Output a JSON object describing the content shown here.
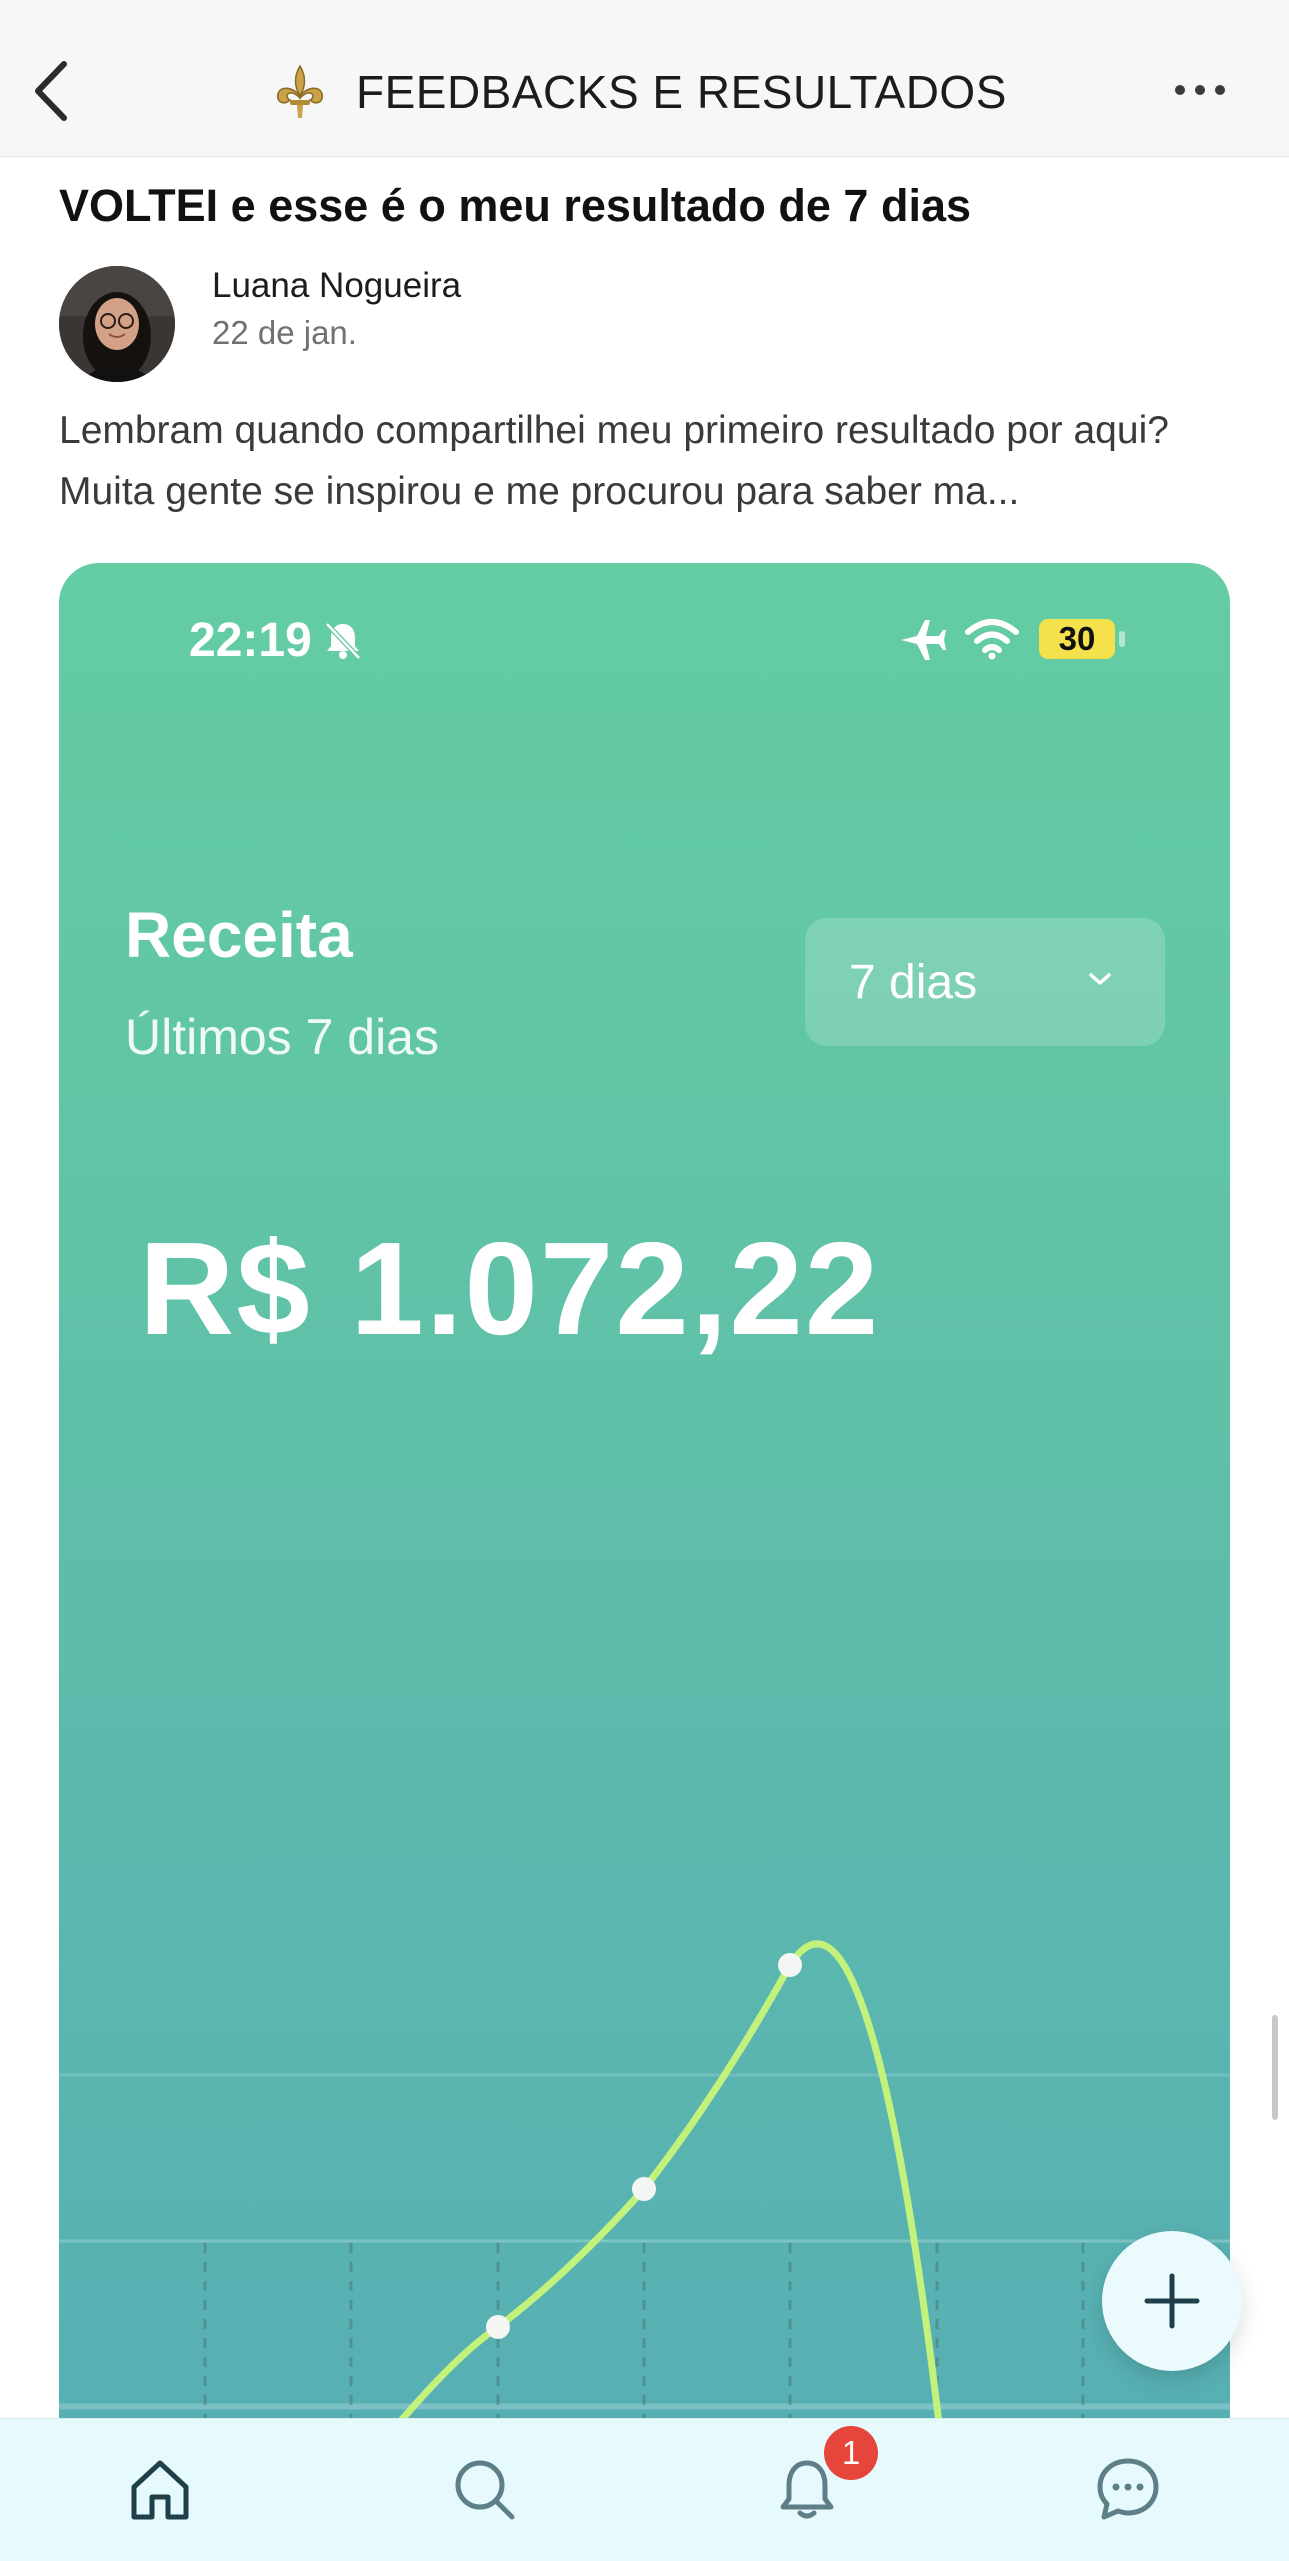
{
  "header": {
    "title": "FEEDBACKS E RESULTADOS",
    "back_icon": "chevron-left-icon",
    "emblem_icon": "fleur-de-lis-icon",
    "more_icon": "ellipsis-icon"
  },
  "post": {
    "title": "VOLTEI e esse é o meu resultado de 7 dias",
    "author": "Luana Nogueira",
    "date": "22 de jan.",
    "excerpt": "Lembram quando compartilhei meu primeiro resultado por aqui?  Muita gente se inspirou e me procurou para saber ma..."
  },
  "screenshot": {
    "status_time": "22:19",
    "battery": "30",
    "card_title": "Receita",
    "card_subtitle": "Últimos 7 dias",
    "period_select": "7 dias",
    "amount": "R$ 1.072,22",
    "accent_colors": {
      "card_top": "#64cda3",
      "card_bottom": "#57afb4",
      "line": "#c3f27c",
      "battery": "#f4e14b"
    }
  },
  "bottom_nav": {
    "items": [
      "home-icon",
      "search-icon",
      "bell-icon",
      "chat-icon"
    ],
    "notification_count": "1"
  },
  "fab_icon": "plus-icon"
}
